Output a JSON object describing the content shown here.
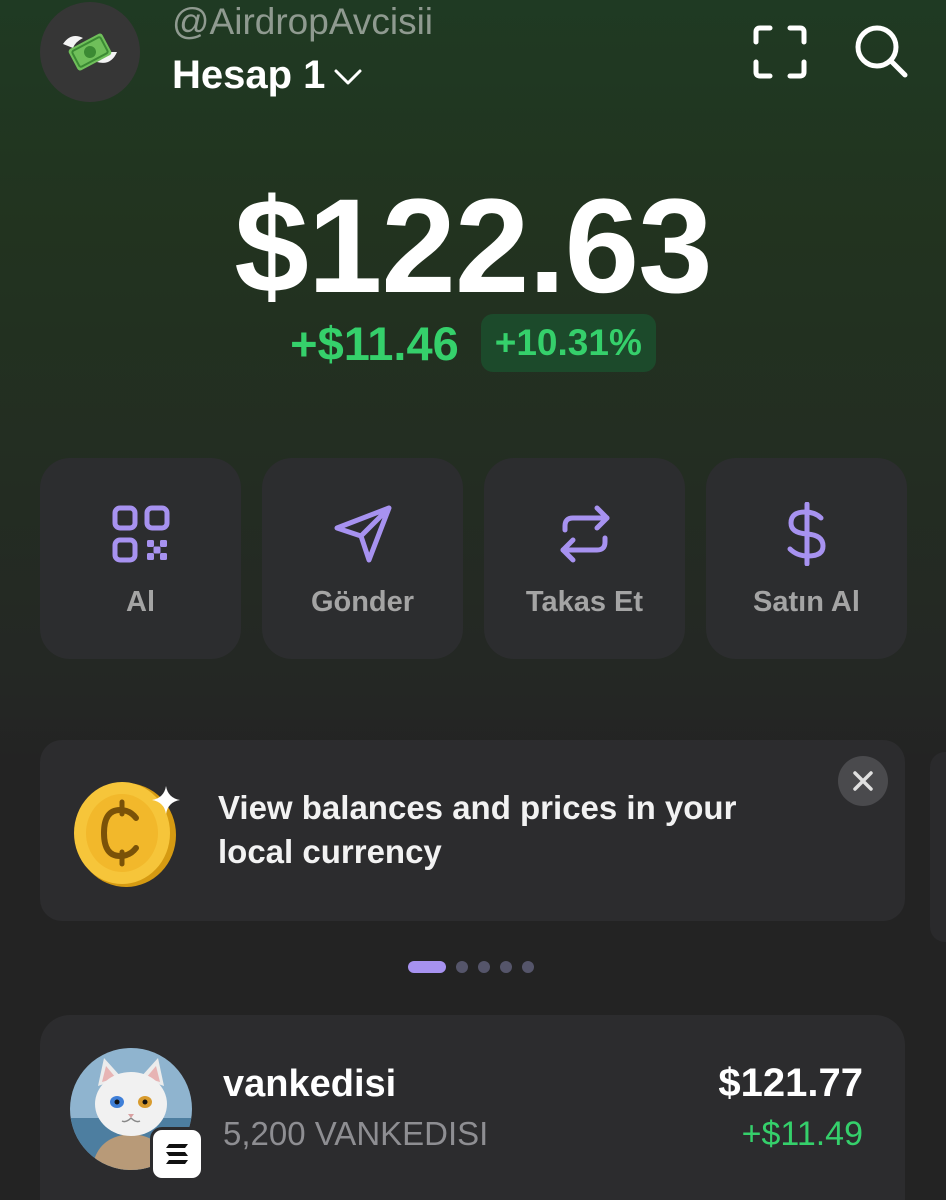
{
  "header": {
    "username": "@AirdropAvcisii",
    "account_name": "Hesap 1",
    "avatar_icon": "flying-money-icon",
    "scan_icon": "scan-icon",
    "search_icon": "search-icon"
  },
  "portfolio": {
    "balance": "$122.63",
    "change_amount": "+$11.46",
    "change_percent": "+10.31%"
  },
  "actions": [
    {
      "label": "Al",
      "icon": "qr-code-icon"
    },
    {
      "label": "Gönder",
      "icon": "send-icon"
    },
    {
      "label": "Takas Et",
      "icon": "swap-icon"
    },
    {
      "label": "Satın Al",
      "icon": "dollar-icon"
    }
  ],
  "banner": {
    "text": "View balances and prices in your local currency",
    "icon": "coin-sparkle-icon",
    "close_icon": "close-icon"
  },
  "pager": {
    "count": 5,
    "active_index": 0
  },
  "tokens": [
    {
      "name": "vankedisi",
      "quantity": "5,200 VANKEDISI",
      "value": "$121.77",
      "change": "+$11.49",
      "chain_icon": "solana-icon"
    }
  ],
  "colors": {
    "accent": "#a792f0",
    "positive": "#35d06b",
    "card": "#2c2d2f"
  }
}
